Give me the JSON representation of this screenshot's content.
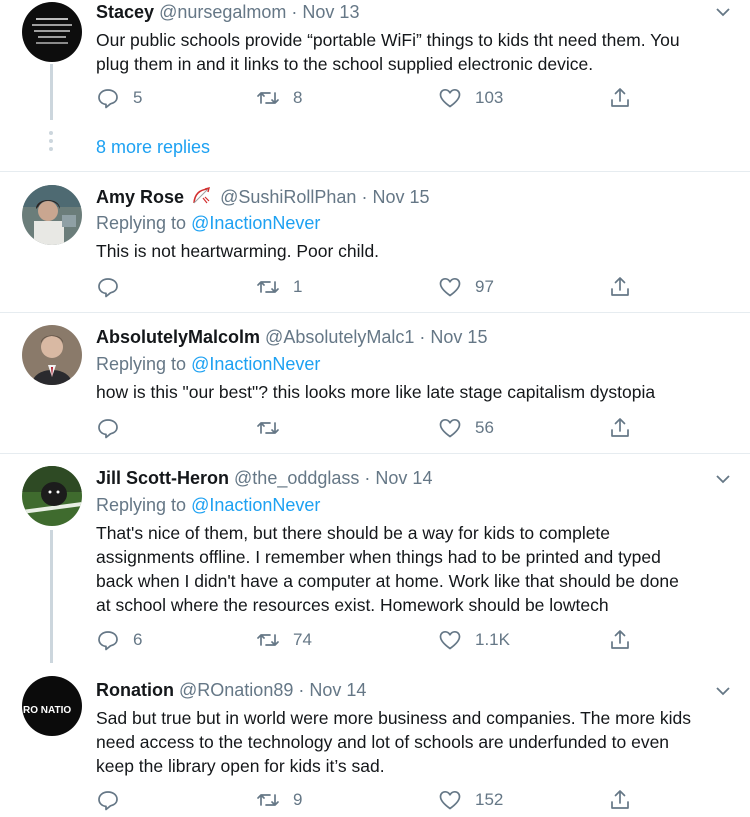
{
  "colors": {
    "accent": "#1da1f2",
    "muted": "#657786",
    "text": "#14171a",
    "divider": "#e6ecf0"
  },
  "thread_top": {
    "name": "Stacey",
    "handle": "@nursegalmom",
    "separator": "·",
    "date": "Nov 13",
    "text_lines": [
      "Our public schools provide “portable WiFi” things to kids tht need them. You",
      "plug them in and it links to the school supplied electronic device."
    ],
    "replies": "5",
    "retweets": "8",
    "likes": "103",
    "more_replies": "8 more replies"
  },
  "tweets": [
    {
      "name": "Amy Rose",
      "handle": "@SushiRollPhan",
      "separator": "·",
      "date": "Nov 15",
      "replying_prefix": "Replying to",
      "replying_to": "@InactionNever",
      "text_lines": [
        "This is not heartwarming. Poor child."
      ],
      "replies": "",
      "retweets": "1",
      "likes": "97"
    },
    {
      "name": "AbsolutelyMalcolm",
      "handle": "@AbsolutelyMalc1",
      "separator": "·",
      "date": "Nov 15",
      "replying_prefix": "Replying to",
      "replying_to": "@InactionNever",
      "text_lines": [
        "how is this \"our best\"? this looks more like late stage capitalism dystopia"
      ],
      "replies": "",
      "retweets": "",
      "likes": "56"
    },
    {
      "name": "Jill Scott-Heron",
      "handle": "@the_oddglass",
      "separator": "·",
      "date": "Nov 14",
      "replying_prefix": "Replying to",
      "replying_to": "@InactionNever",
      "text_lines": [
        "That's nice of them, but there should be a way for kids to complete",
        "assignments offline. I remember when things had to be printed and typed",
        "back when I didn't have a computer at home. Work like that should be done",
        "at school where the resources exist. Homework should be lowtech"
      ],
      "replies": "6",
      "retweets": "74",
      "likes": "1.1K"
    },
    {
      "name": "Ronation",
      "handle": "@ROnation89",
      "separator": "·",
      "date": "Nov 14",
      "avatar_text": "RO NATIO",
      "text_lines": [
        "Sad but true but in world were more business and companies. The more kids",
        "need access to the technology and lot of schools are underfunded to even",
        "keep the library open for kids it’s sad."
      ],
      "replies": "",
      "retweets": "9",
      "likes": "152"
    }
  ]
}
